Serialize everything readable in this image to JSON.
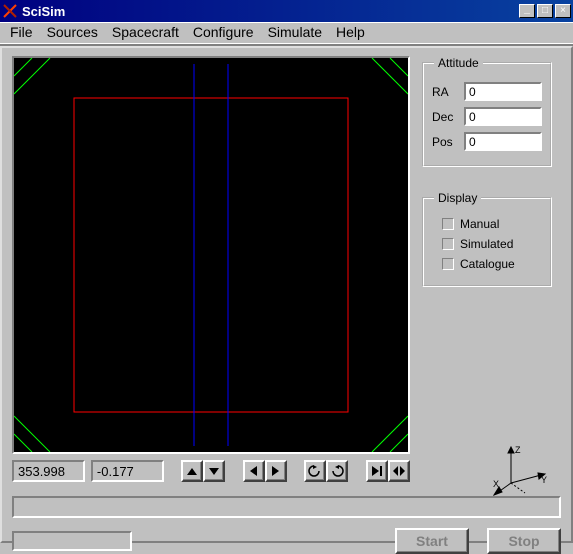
{
  "window": {
    "title": "SciSim"
  },
  "menu": {
    "file": "File",
    "sources": "Sources",
    "spacecraft": "Spacecraft",
    "configure": "Configure",
    "simulate": "Simulate",
    "help": "Help"
  },
  "viewport": {
    "coord_x": "353.998",
    "coord_y": "-0.177"
  },
  "attitude": {
    "legend": "Attitude",
    "ra_label": "RA",
    "ra_value": "0",
    "dec_label": "Dec",
    "dec_value": "0",
    "pos_label": "Pos",
    "pos_value": "0"
  },
  "display": {
    "legend": "Display",
    "manual_label": "Manual",
    "manual_checked": false,
    "simulated_label": "Simulated",
    "simulated_checked": false,
    "catalogue_label": "Catalogue",
    "catalogue_checked": false
  },
  "axes": {
    "x": "X",
    "y": "Y",
    "z": "Z"
  },
  "buttons": {
    "start": "Start",
    "stop": "Stop"
  },
  "icons": {
    "min": "_",
    "max": "□",
    "close": "×"
  }
}
